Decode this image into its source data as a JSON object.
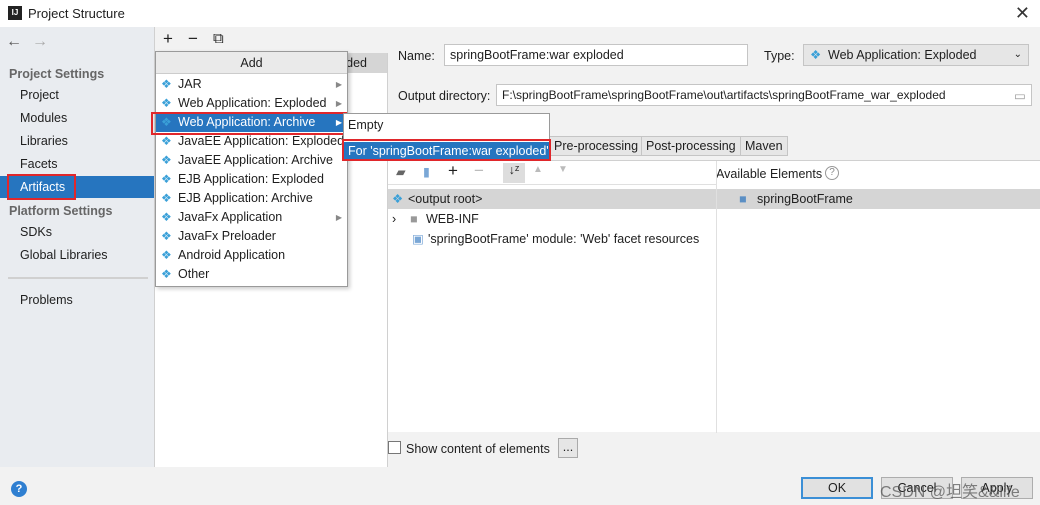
{
  "window": {
    "title": "Project Structure",
    "close": "✕",
    "logo": "IJ"
  },
  "nav": {
    "back": "←",
    "forward": "→"
  },
  "sidebar": {
    "project_settings": "Project Settings",
    "items": [
      "Project",
      "Modules",
      "Libraries",
      "Facets",
      "Artifacts"
    ],
    "platform_settings": "Platform Settings",
    "platform_items": [
      "SDKs",
      "Global Libraries"
    ],
    "problems": "Problems",
    "selected": "Artifacts"
  },
  "middle": {
    "toolbar": {
      "add": "+",
      "remove": "−",
      "copy": "⧉"
    },
    "list_item": "springBootFrame:war exploded"
  },
  "add_menu": {
    "header": "Add",
    "items": [
      {
        "label": "JAR",
        "submenu": true
      },
      {
        "label": "Web Application: Exploded",
        "submenu": true
      },
      {
        "label": "Web Application: Archive",
        "submenu": true,
        "selected": true
      },
      {
        "label": "JavaEE Application: Exploded",
        "submenu": false
      },
      {
        "label": "JavaEE Application: Archive",
        "submenu": false
      },
      {
        "label": "EJB Application: Exploded",
        "submenu": false
      },
      {
        "label": "EJB Application: Archive",
        "submenu": false
      },
      {
        "label": "JavaFx Application",
        "submenu": true
      },
      {
        "label": "JavaFx Preloader",
        "submenu": false
      },
      {
        "label": "Android Application",
        "submenu": false
      },
      {
        "label": "Other",
        "submenu": false
      }
    ]
  },
  "submenu": {
    "items": [
      "Empty",
      "For 'springBootFrame:war exploded'"
    ],
    "selected": "For 'springBootFrame:war exploded'"
  },
  "details": {
    "name_label": "Name:",
    "name_value": "springBootFrame:war exploded",
    "type_label": "Type:",
    "type_value": "Web Application: Exploded",
    "output_label": "Output directory:",
    "output_value": "F:\\springBootFrame\\springBootFrame\\out\\artifacts\\springBootFrame_war_exploded",
    "tabs": [
      "Pre-processing",
      "Post-processing",
      "Maven"
    ],
    "tree": [
      "<output root>",
      "WEB-INF",
      "'springBootFrame' module: 'Web' facet resources"
    ],
    "available_label": "Available Elements",
    "available_items": [
      "springBootFrame"
    ],
    "show_content": "Show content of elements",
    "ellipsis": "..."
  },
  "buttons": {
    "ok": "OK",
    "cancel": "Cancel",
    "apply": "Apply",
    "help": "?"
  },
  "watermark": "CSDN @坦笑&&life",
  "colors": {
    "selection": "#2675bf",
    "highlight_box": "#e0272b"
  }
}
